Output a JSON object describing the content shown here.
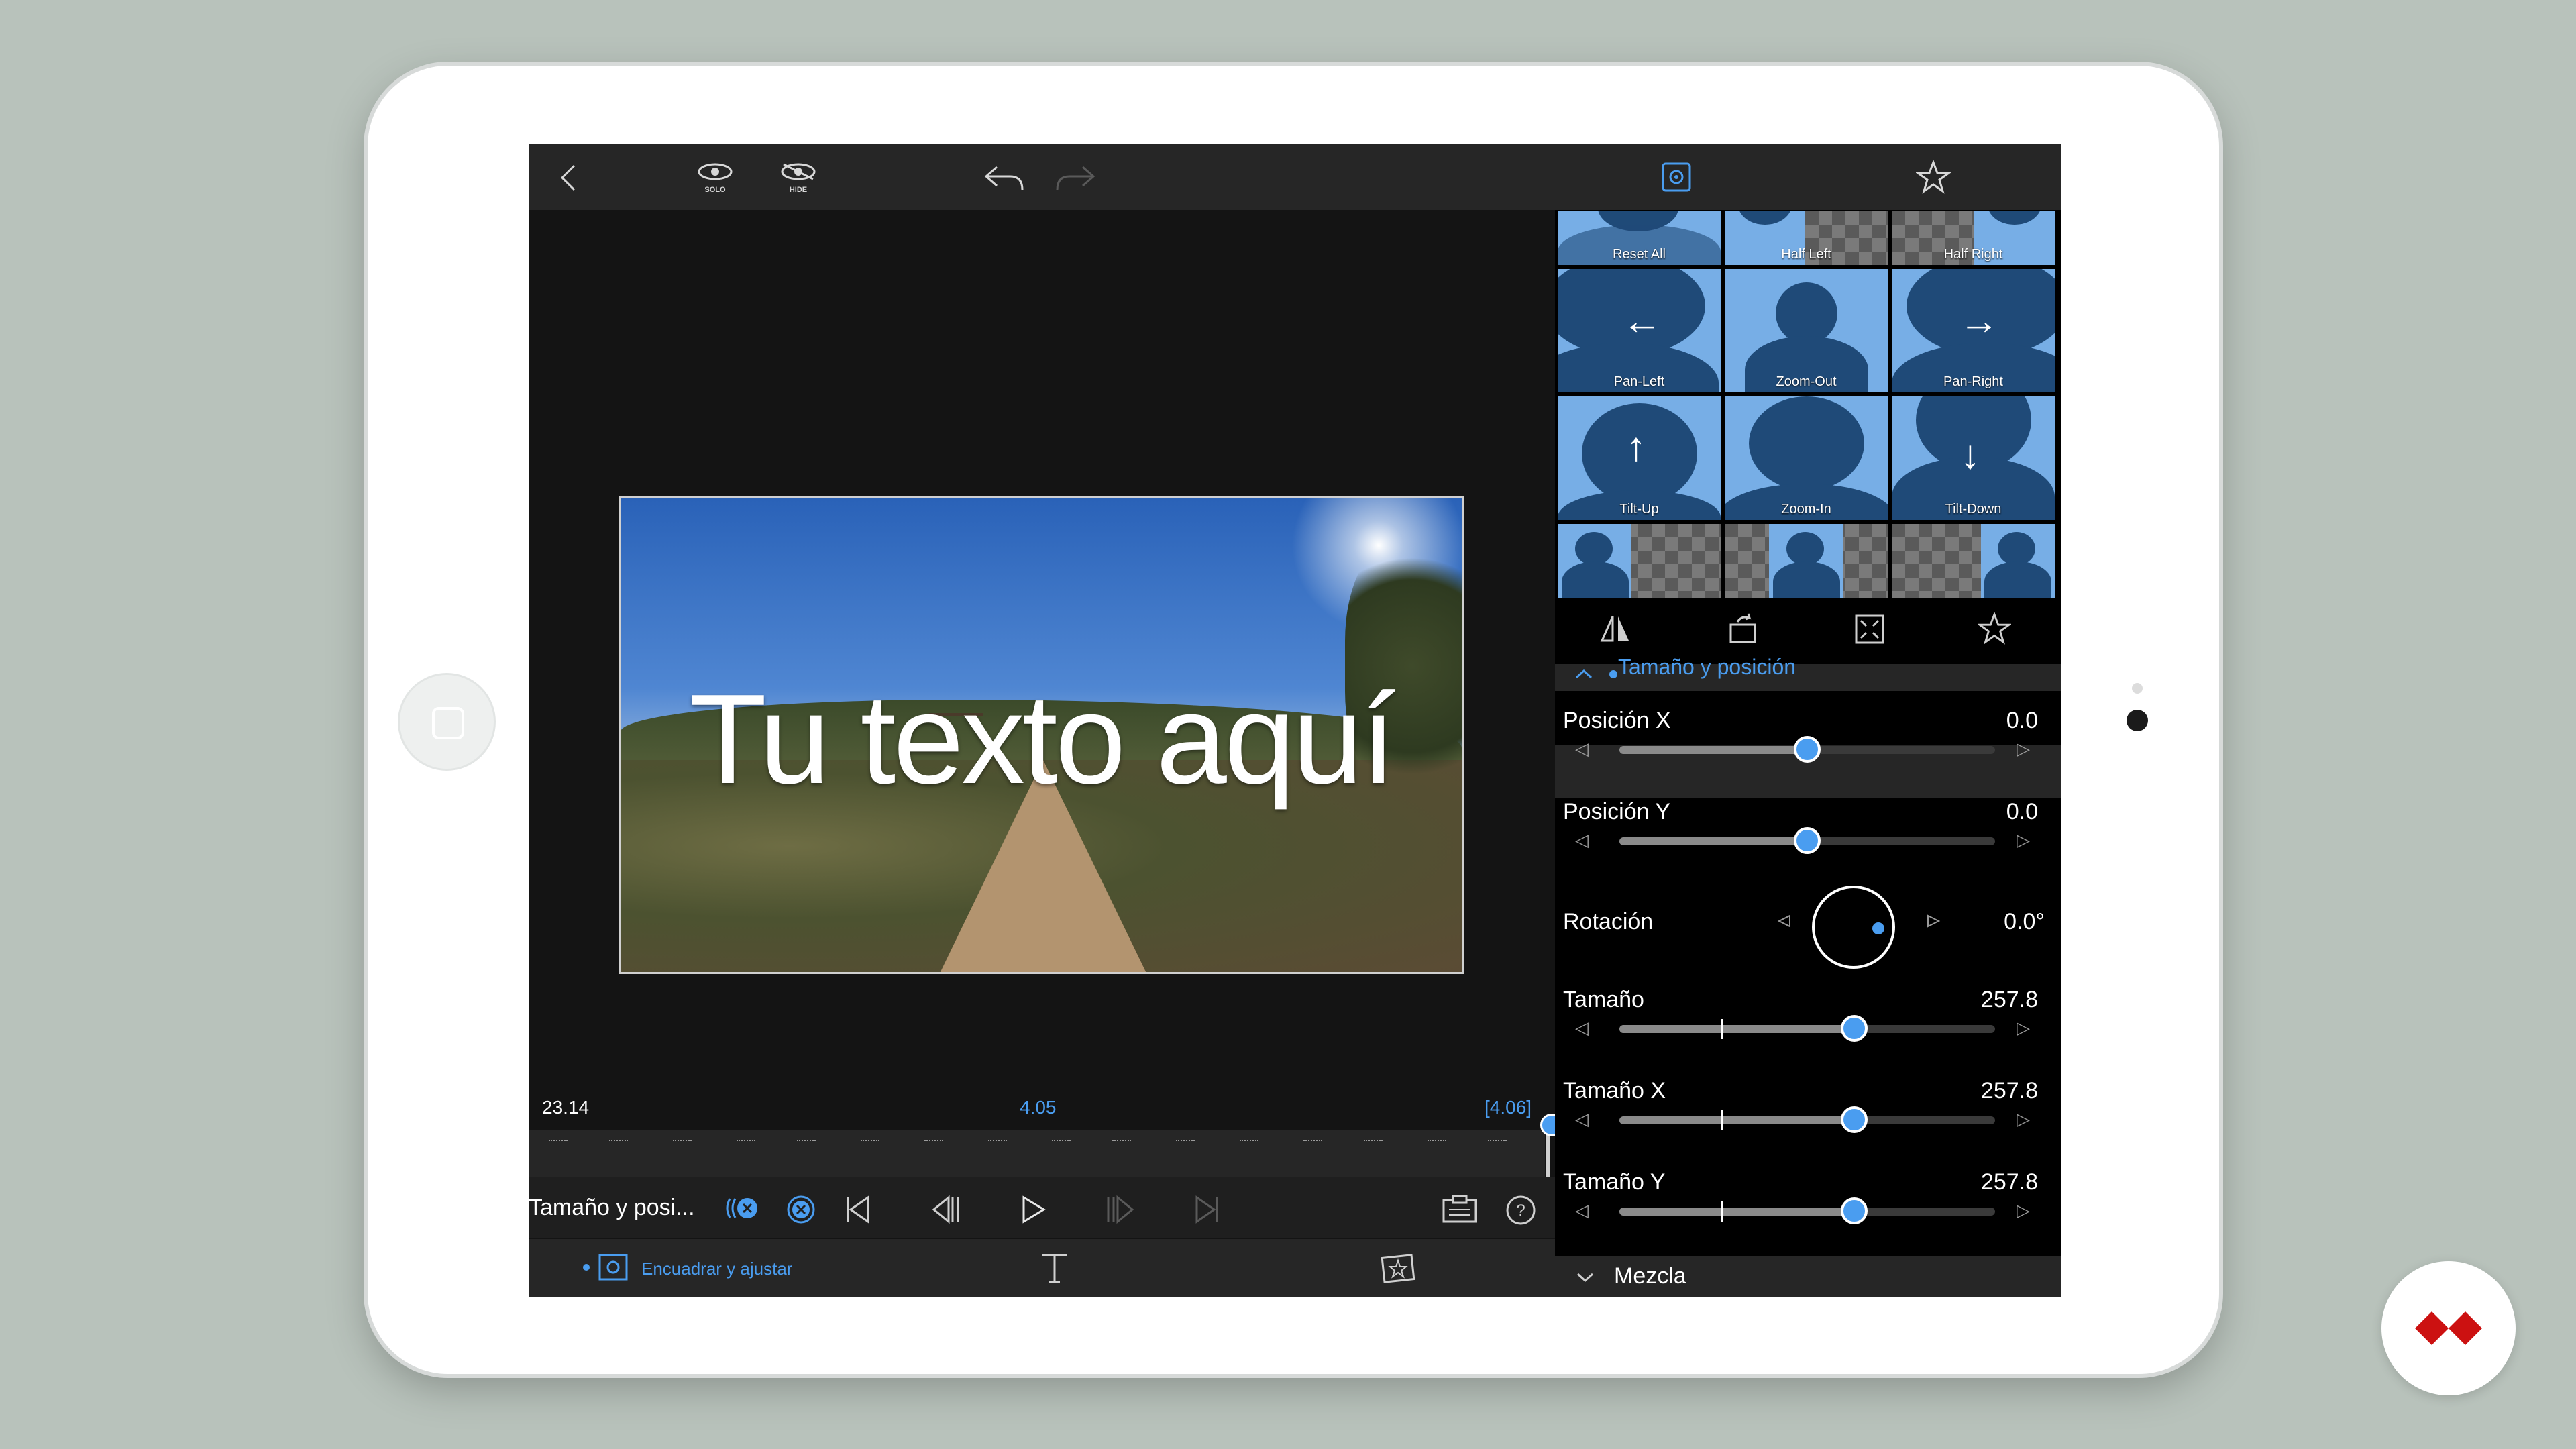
{
  "toolbar": {
    "solo_label": "SOLO",
    "hide_label": "HIDE"
  },
  "preview": {
    "overlay_text": "Tu texto aquí",
    "timecode_left": "23.14",
    "timecode_center": "4.05",
    "timecode_right": "[4.06]"
  },
  "controls": {
    "current_effect_label": "Tamaño y posi..."
  },
  "bottombar": {
    "fit_label": "Encuadrar y ajustar"
  },
  "presets": [
    {
      "label": "Reset All"
    },
    {
      "label": "Half Left"
    },
    {
      "label": "Half Right"
    },
    {
      "label": "Pan-Left"
    },
    {
      "label": "Zoom-Out"
    },
    {
      "label": "Pan-Right"
    },
    {
      "label": "Tilt-Up"
    },
    {
      "label": "Zoom-In"
    },
    {
      "label": "Tilt-Down"
    }
  ],
  "section": {
    "title": "Tamaño y posición"
  },
  "params": {
    "pos_x": {
      "label": "Posición X",
      "value": "0.0",
      "fraction": 0.5
    },
    "pos_y": {
      "label": "Posición Y",
      "value": "0.0",
      "fraction": 0.5
    },
    "rotation": {
      "label": "Rotación",
      "value": "0.0°"
    },
    "size": {
      "label": "Tamaño",
      "value": "257.8",
      "fraction": 0.625
    },
    "size_x": {
      "label": "Tamaño X",
      "value": "257.8",
      "fraction": 0.625
    },
    "size_y": {
      "label": "Tamaño Y",
      "value": "257.8",
      "fraction": 0.625
    }
  },
  "mezcla": {
    "label": "Mezcla"
  },
  "colors": {
    "accent": "#4a9df0",
    "panel_bg": "#000000",
    "toolbar_bg": "#262626"
  }
}
